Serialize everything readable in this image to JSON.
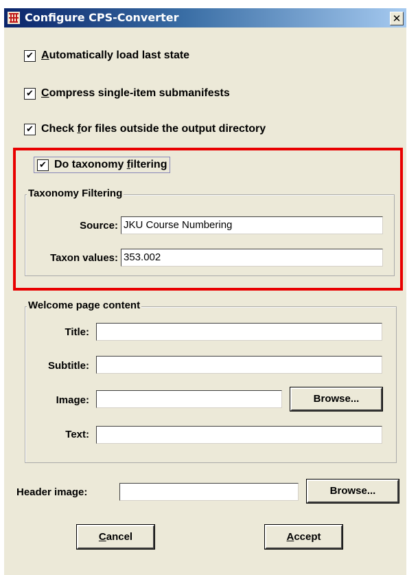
{
  "window": {
    "title": "Configure CPS-Converter"
  },
  "checkboxes": [
    {
      "label_pre": "",
      "mnemonic": "A",
      "label_post": "utomatically load last state",
      "checked_glyph": "✔"
    },
    {
      "label_pre": "",
      "mnemonic": "C",
      "label_post": "ompress single-item submanifests",
      "checked_glyph": "✔"
    },
    {
      "label_pre": "Check ",
      "mnemonic": "f",
      "label_post": "or files outside the output directory",
      "checked_glyph": "✔"
    },
    {
      "label_pre": "Do taxonomy ",
      "mnemonic": "f",
      "label_post": "iltering",
      "checked_glyph": "✔"
    }
  ],
  "taxonomy": {
    "group_title": "Taxonomy Filtering",
    "source_label": "Source:",
    "source_value": "JKU Course Numbering",
    "taxon_label": "Taxon values:",
    "taxon_value": "353.002"
  },
  "welcome": {
    "group_title": "Welcome page content",
    "title_label": "Title:",
    "subtitle_label": "Subtitle:",
    "image_label": "Image:",
    "browse_label": "Browse...",
    "text_label": "Text:"
  },
  "header": {
    "label": "Header image:",
    "browse_label": "Browse..."
  },
  "buttons": {
    "cancel_mnemonic": "C",
    "cancel_rest": "ancel",
    "accept_mnemonic": "A",
    "accept_rest": "ccept"
  },
  "colors": {
    "highlight_frame": "#e80000",
    "titlebar": "#0a246a",
    "dialog_bg": "#ece9d8"
  },
  "icons": {
    "app": "app-icon",
    "close": "close-icon",
    "check": "check-icon"
  }
}
